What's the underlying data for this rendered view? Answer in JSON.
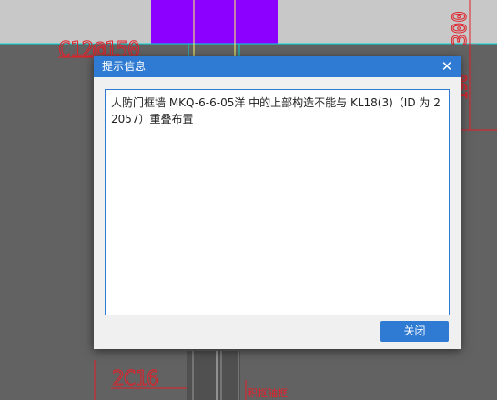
{
  "drawing": {
    "label_top": "C12@150",
    "label_bottom": "2C16",
    "dim_text": "300",
    "side_text_partial": "190",
    "vertical_text": "积抠轴框"
  },
  "dialog": {
    "title": "提示信息",
    "close_glyph": "✕",
    "message": "人防门框墙 MKQ-6-6-05洋 中的上部构造不能与 KL18(3)（ID 为 22057）重叠布置",
    "ok_label": "关闭"
  },
  "colors": {
    "accent": "#2f7bd3",
    "cad_background": "#626262",
    "cad_red": "#e0202a",
    "cad_purple": "#8b00ff",
    "cad_cyan": "#00d8d8"
  }
}
